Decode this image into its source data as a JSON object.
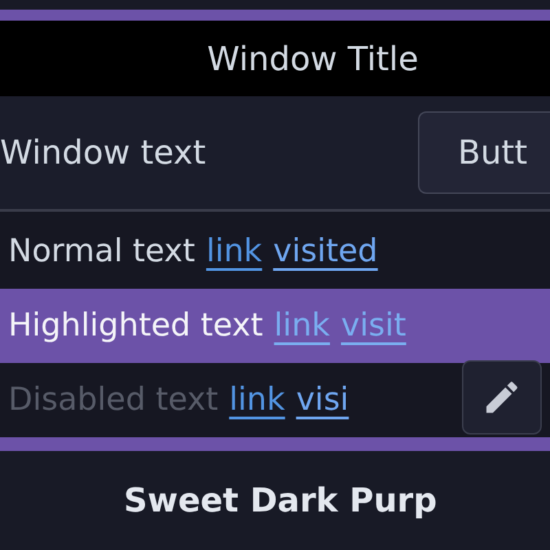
{
  "window": {
    "title": "Window Title",
    "text": "Window text",
    "button": "Butt"
  },
  "rows": [
    {
      "kind": "normal",
      "text": "Normal text",
      "link": "link",
      "visited": "visited"
    },
    {
      "kind": "highlighted",
      "text": "Highlighted text",
      "link": "link",
      "visited": "visit"
    },
    {
      "kind": "disabled",
      "text": "Disabled text",
      "link": "link",
      "visited": "visi"
    }
  ],
  "theme_name": "Sweet Dark Purp"
}
